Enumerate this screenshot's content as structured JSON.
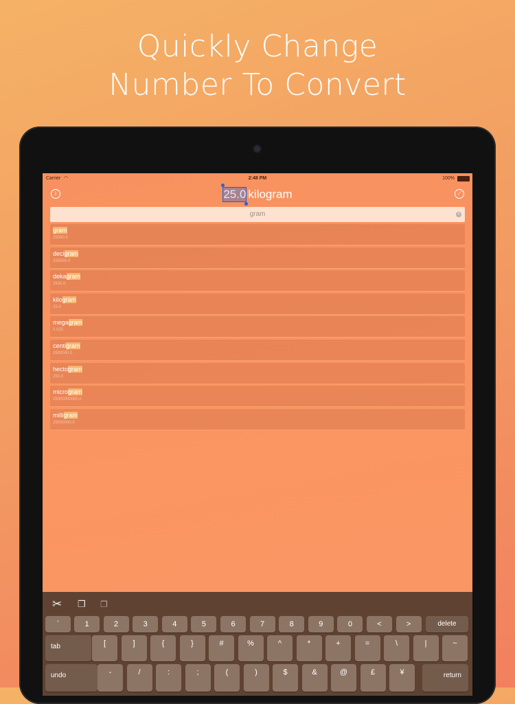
{
  "headline": {
    "line1": "Quickly Change",
    "line2": "Number To Convert"
  },
  "status_bar": {
    "carrier": "Carrier",
    "time": "2:48 PM",
    "battery": "100%"
  },
  "nav": {
    "number": "25.0",
    "unit": "kilogram"
  },
  "search": {
    "query": "gram"
  },
  "results": [
    {
      "prefix": "",
      "match": "gram",
      "value": "25000.0"
    },
    {
      "prefix": "deci",
      "match": "gram",
      "value": "250000.0"
    },
    {
      "prefix": "deka",
      "match": "gram",
      "value": "2500.0"
    },
    {
      "prefix": "kilo",
      "match": "gram",
      "value": "25.0"
    },
    {
      "prefix": "mega",
      "match": "gram",
      "value": "0.025"
    },
    {
      "prefix": "centi",
      "match": "gram",
      "value": "2500000.0"
    },
    {
      "prefix": "hecto",
      "match": "gram",
      "value": "250.0"
    },
    {
      "prefix": "micro",
      "match": "gram",
      "value": "25000000000.0"
    },
    {
      "prefix": "milli",
      "match": "gram",
      "value": "25000000.0"
    }
  ],
  "keyboard": {
    "row1": [
      "`",
      "1",
      "2",
      "3",
      "4",
      "5",
      "6",
      "7",
      "8",
      "9",
      "0",
      "<",
      ">"
    ],
    "delete": "delete",
    "tab": "tab",
    "row2": [
      "[",
      "]",
      "{",
      "}",
      "#",
      "%",
      "^",
      "*",
      "+",
      "=",
      "\\",
      "|",
      "~"
    ],
    "undo": "undo",
    "row3": [
      "-",
      "/",
      ":",
      ";",
      "(",
      ")",
      "$",
      "&",
      "@",
      "£",
      "¥"
    ],
    "return": "return"
  }
}
